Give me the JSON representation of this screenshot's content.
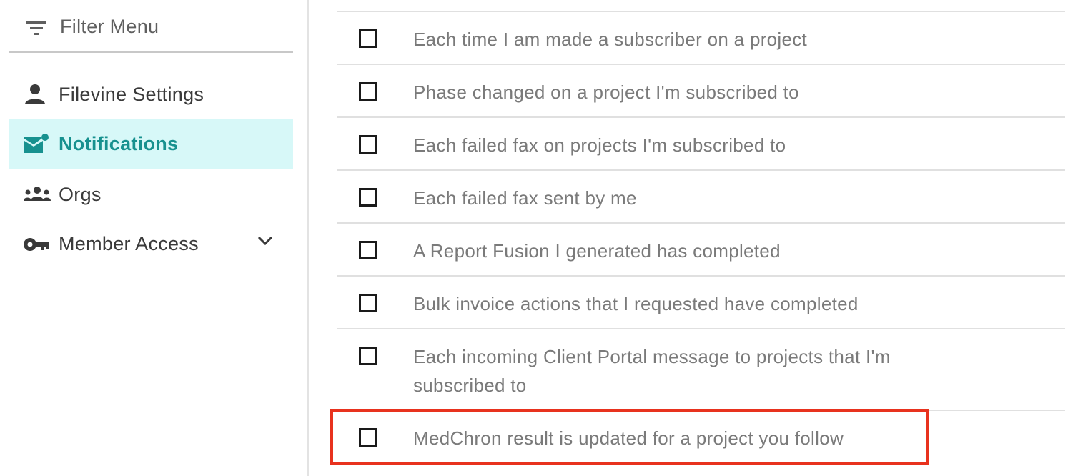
{
  "sidebar": {
    "filter": {
      "label": "Filter Menu",
      "icon": "filter-icon"
    },
    "items": [
      {
        "label": "Filevine Settings",
        "icon": "person-icon",
        "active": false
      },
      {
        "label": "Notifications",
        "icon": "mail-notification-icon",
        "active": true
      },
      {
        "label": "Orgs",
        "icon": "group-icon",
        "active": false
      },
      {
        "label": "Member Access",
        "icon": "key-icon",
        "active": false,
        "expandable": true,
        "expand_icon": "chevron-down-icon"
      }
    ]
  },
  "notifications": {
    "rows": [
      {
        "text": "Each time I am made a subscriber on a project",
        "checked": false
      },
      {
        "text": "Phase changed on a project I'm subscribed to",
        "checked": false
      },
      {
        "text": "Each failed fax on projects I'm subscribed to",
        "checked": false
      },
      {
        "text": "Each failed fax sent by me",
        "checked": false
      },
      {
        "text": "A Report Fusion I generated has completed",
        "checked": false
      },
      {
        "text": "Bulk invoice actions that I requested have completed",
        "checked": false
      },
      {
        "text": "Each incoming Client Portal message to projects that I'm subscribed to",
        "checked": false
      },
      {
        "text": "MedChron result is updated for a project you follow",
        "checked": false,
        "highlighted": true
      }
    ]
  },
  "colors": {
    "accent": "#17918f",
    "active_bg": "#d7f8f8",
    "highlight_border": "#e8321e"
  }
}
